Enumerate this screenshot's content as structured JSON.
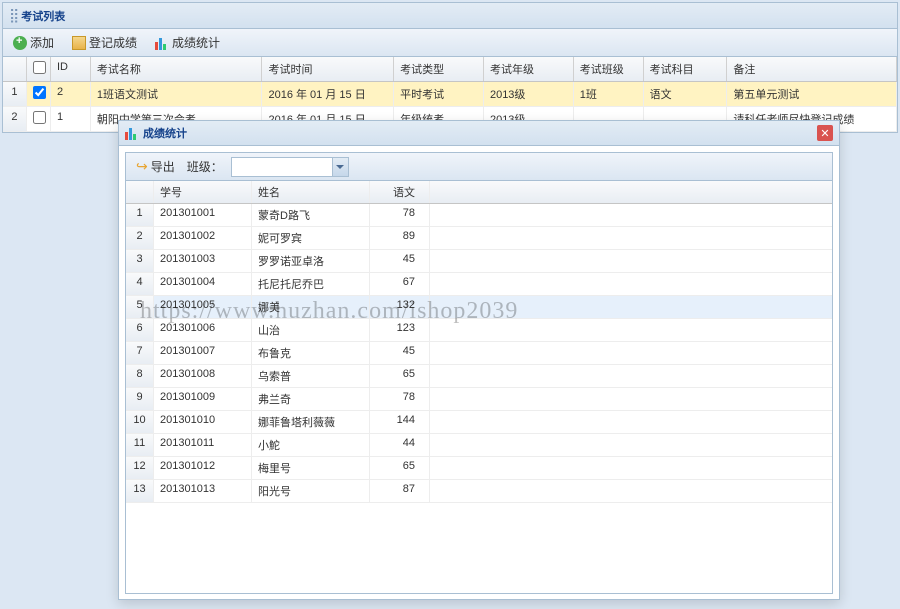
{
  "main": {
    "title": "考试列表",
    "toolbar": {
      "add": "添加",
      "register": "登记成绩",
      "stats": "成绩统计"
    },
    "headers": {
      "id": "ID",
      "name": "考试名称",
      "time": "考试时间",
      "type": "考试类型",
      "grade": "考试年级",
      "class": "考试班级",
      "subject": "考试科目",
      "note": "备注"
    },
    "rows": [
      {
        "num": "1",
        "checked": true,
        "id": "2",
        "name": "1班语文测试",
        "time": "2016 年 01 月 15 日",
        "type": "平时考试",
        "grade": "2013级",
        "class": "1班",
        "subject": "语文",
        "note": "第五单元测试"
      },
      {
        "num": "2",
        "checked": false,
        "id": "1",
        "name": "朝阳中学第三次会考",
        "time": "2016 年 01 月 15 日",
        "type": "年级统考",
        "grade": "2013级",
        "class": "",
        "subject": "",
        "note": "请科任老师尽快登记成绩"
      }
    ]
  },
  "dialog": {
    "title": "成绩统计",
    "export": "导出",
    "class_label": "班级：",
    "class_value": "",
    "headers": {
      "sid": "学号",
      "name": "姓名",
      "score": "语文"
    },
    "rows": [
      {
        "num": "1",
        "sid": "201301001",
        "name": "蒙奇D路飞",
        "score": "78"
      },
      {
        "num": "2",
        "sid": "201301002",
        "name": "妮可罗宾",
        "score": "89"
      },
      {
        "num": "3",
        "sid": "201301003",
        "name": "罗罗诺亚卓洛",
        "score": "45"
      },
      {
        "num": "4",
        "sid": "201301004",
        "name": "托尼托尼乔巴",
        "score": "67"
      },
      {
        "num": "5",
        "sid": "201301005",
        "name": "娜美",
        "score": "132"
      },
      {
        "num": "6",
        "sid": "201301006",
        "name": "山治",
        "score": "123"
      },
      {
        "num": "7",
        "sid": "201301007",
        "name": "布鲁克",
        "score": "45"
      },
      {
        "num": "8",
        "sid": "201301008",
        "name": "乌索普",
        "score": "65"
      },
      {
        "num": "9",
        "sid": "201301009",
        "name": "弗兰奇",
        "score": "78"
      },
      {
        "num": "10",
        "sid": "201301010",
        "name": "娜菲鲁塔利薇薇",
        "score": "144"
      },
      {
        "num": "11",
        "sid": "201301011",
        "name": "小鮀",
        "score": "44"
      },
      {
        "num": "12",
        "sid": "201301012",
        "name": "梅里号",
        "score": "65"
      },
      {
        "num": "13",
        "sid": "201301013",
        "name": "阳光号",
        "score": "87"
      }
    ],
    "highlight_index": 4
  },
  "watermark": "https://www.huzhan.com/ishop2039"
}
